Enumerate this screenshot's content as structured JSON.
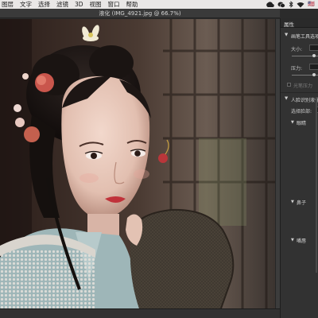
{
  "menubar": {
    "items": [
      "图层",
      "文字",
      "选择",
      "滤镜",
      "3D",
      "视图",
      "窗口",
      "帮助"
    ],
    "status_flag": "🇺🇸"
  },
  "document": {
    "title": "液化 (IMG_4921.jpg @ 66.7%)"
  },
  "panel": {
    "tab_label": "属性",
    "brush_section": "画笔工具选项",
    "size_label": "大小:",
    "pressure_label": "压力:",
    "stylus_label": "光笔压力",
    "face_section": "人脸识别液化",
    "select_face_label": "选择脸部:",
    "eyes_label": "眼睛",
    "nose_label": "鼻子",
    "mouth_label": "嘴唇"
  },
  "colors": {
    "menubar_bg": "#e9e7e6",
    "panel_bg": "#323232",
    "app_bg": "#2b2b2b"
  }
}
